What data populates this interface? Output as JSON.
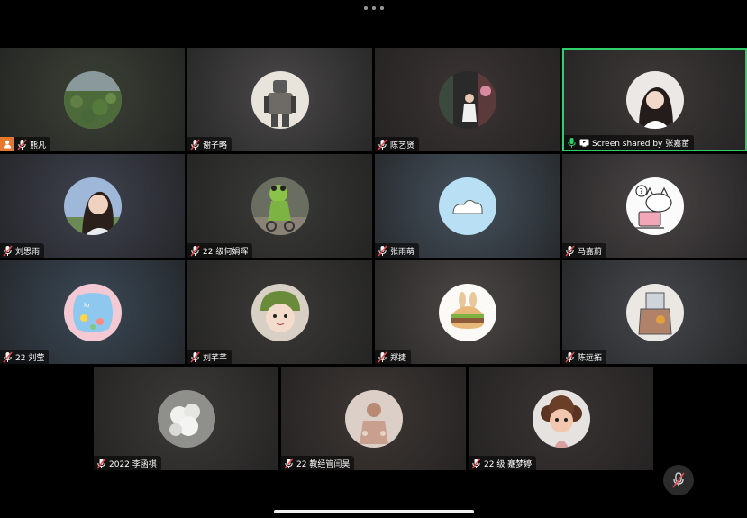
{
  "app": {
    "more_icon": "more-dots-icon",
    "mute_icon": "mic-muted-icon"
  },
  "participants": [
    {
      "name": "熊凡",
      "muted": true,
      "badge": "person-icon",
      "bg": "#3b4136",
      "avatar": "lotus-pond"
    },
    {
      "name": "谢子略",
      "muted": true,
      "bg": "#4a4848",
      "avatar": "robot-figure"
    },
    {
      "name": "陈艺贤",
      "muted": true,
      "bg": "#3c3434",
      "avatar": "girl-street"
    },
    {
      "name": "Screen shared by 张嘉苗",
      "muted": false,
      "screen_share": true,
      "active": true,
      "bg": "#3e3a39",
      "avatar": "girl-portrait"
    },
    {
      "name": "刘思雨",
      "muted": true,
      "bg": "#3f424f",
      "avatar": "woman-smiling"
    },
    {
      "name": "22 级何娟晖",
      "muted": true,
      "bg": "#3a3a37",
      "avatar": "frog-costume"
    },
    {
      "name": "张雨萌",
      "muted": true,
      "bg": "#46525e",
      "avatar": "cartoon-cloud"
    },
    {
      "name": "马嘉蔚",
      "muted": true,
      "bg": "#4a4546",
      "avatar": "kitty-laptop"
    },
    {
      "name": "22 刘莹",
      "muted": true,
      "bg": "#3b4957",
      "avatar": "flower-card"
    },
    {
      "name": "刘芊芊",
      "muted": true,
      "bg": "#3b3a38",
      "avatar": "baby-frog-hat"
    },
    {
      "name": "郑捷",
      "muted": true,
      "bg": "#4b4745",
      "avatar": "bunny-burger"
    },
    {
      "name": "陈远拓",
      "muted": true,
      "bg": "#45484c",
      "avatar": "sketch-character"
    },
    {
      "name": "2022 李函祺",
      "muted": true,
      "bg": "#3c3a38",
      "avatar": "white-flowers"
    },
    {
      "name": "22 教经管闫昊",
      "muted": true,
      "bg": "#3e3734",
      "avatar": "blurred-figure"
    },
    {
      "name": "22 级 蹇梦婷",
      "muted": true,
      "bg": "#3a3433",
      "avatar": "doll-girl"
    }
  ],
  "colors": {
    "active_border": "#2fcf6a",
    "badge_orange": "#e8772e",
    "mic_muted_red": "#e5484d",
    "mic_active_green": "#2fcf6a"
  }
}
